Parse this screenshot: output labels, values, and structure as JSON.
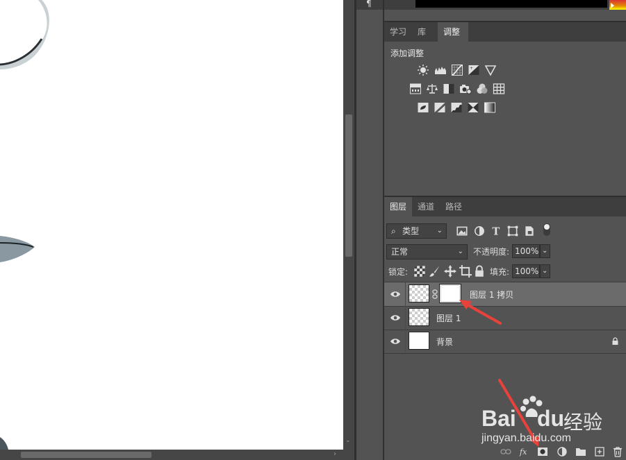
{
  "panel_tabs_top": [
    {
      "label": "学习",
      "active": false
    },
    {
      "label": "库",
      "active": false
    },
    {
      "label": "调整",
      "active": true
    }
  ],
  "adjustments": {
    "title": "添加调整",
    "rows": [
      [
        "brightness-contrast-icon",
        "levels-icon",
        "curves-icon",
        "exposure-icon",
        "vibrance-icon"
      ],
      [
        "hue-saturation-icon",
        "color-balance-icon",
        "black-white-icon",
        "photo-filter-icon",
        "channel-mixer-icon",
        "color-lookup-icon"
      ],
      [
        "invert-icon",
        "posterize-icon",
        "threshold-icon",
        "selective-color-icon",
        "gradient-map-icon"
      ]
    ]
  },
  "layers_tabs": [
    {
      "label": "图层",
      "active": true
    },
    {
      "label": "通道",
      "active": false
    },
    {
      "label": "路径",
      "active": false
    }
  ],
  "filter": {
    "kind_label": "类型"
  },
  "blend": {
    "mode": "正常",
    "opacity_label": "不透明度:",
    "opacity": "100%"
  },
  "lock": {
    "label": "锁定:",
    "fill_label": "填充:",
    "fill": "100%"
  },
  "layers": [
    {
      "name": "图层 1 拷贝",
      "selected": true,
      "has_mask": true,
      "thumb": "transparent"
    },
    {
      "name": "图层 1",
      "selected": false,
      "has_mask": false,
      "thumb": "transparent"
    },
    {
      "name": "背景",
      "selected": false,
      "has_mask": false,
      "thumb": "white",
      "locked": true
    }
  ],
  "watermark": {
    "brand": "Bai",
    "brand2": "du",
    "brand3": "经验",
    "url": "jingyan.baidu.com"
  },
  "colors": {
    "panel_bg": "#535353",
    "tab_bar": "#3e3e3e",
    "selected_layer": "#6b6b6b",
    "arrow": "#e8423a"
  }
}
